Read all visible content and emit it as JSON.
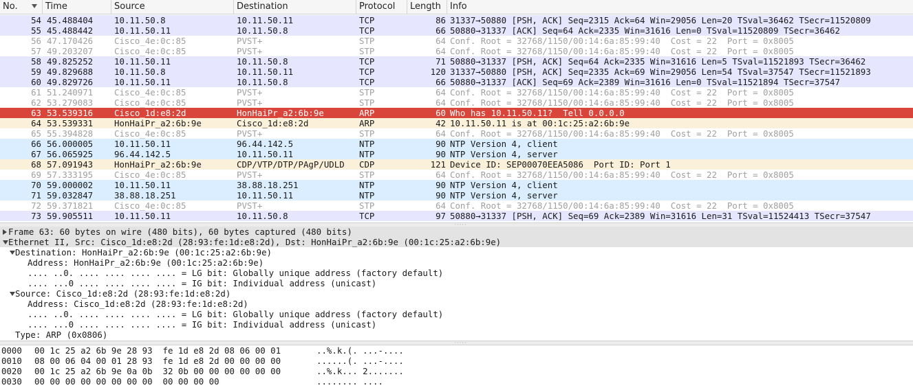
{
  "columns": [
    "No.",
    "Time",
    "Source",
    "Destination",
    "Protocol",
    "Length",
    "Info"
  ],
  "colors": {
    "tcp": "#e7e6ff",
    "stp": "#ffffff",
    "stp_text": "#a0a0a0",
    "selected": "#d9453a",
    "arp": "#fbf0d9",
    "ntp": "#daeeff",
    "cdp": "#fbf0d9"
  },
  "packets": [
    {
      "no": "54",
      "time": "45.488404",
      "src": "10.11.50.8",
      "dst": "10.11.50.11",
      "proto": "TCP",
      "len": "86",
      "info": "31337→50880 [PSH, ACK] Seq=2315 Ack=64 Win=29056 Len=20 TSval=36462 TSecr=11520809",
      "cls": "tcp"
    },
    {
      "no": "55",
      "time": "45.488442",
      "src": "10.11.50.11",
      "dst": "10.11.50.8",
      "proto": "TCP",
      "len": "66",
      "info": "50880→31337 [ACK] Seq=64 Ack=2335 Win=31616 Len=0 TSval=11520809 TSecr=36462",
      "cls": "tcp"
    },
    {
      "no": "56",
      "time": "47.170426",
      "src": "Cisco_4e:0c:85",
      "dst": "PVST+",
      "proto": "STP",
      "len": "64",
      "info": "Conf. Root = 32768/1150/00:14:6a:85:99:40  Cost = 22  Port = 0x8005",
      "cls": "stp"
    },
    {
      "no": "57",
      "time": "49.203207",
      "src": "Cisco_4e:0c:85",
      "dst": "PVST+",
      "proto": "STP",
      "len": "64",
      "info": "Conf. Root = 32768/1150/00:14:6a:85:99:40  Cost = 22  Port = 0x8005",
      "cls": "stp"
    },
    {
      "no": "58",
      "time": "49.825252",
      "src": "10.11.50.11",
      "dst": "10.11.50.8",
      "proto": "TCP",
      "len": "71",
      "info": "50880→31337 [PSH, ACK] Seq=64 Ack=2335 Win=31616 Len=5 TSval=11521893 TSecr=36462",
      "cls": "tcp"
    },
    {
      "no": "59",
      "time": "49.829688",
      "src": "10.11.50.8",
      "dst": "10.11.50.11",
      "proto": "TCP",
      "len": "120",
      "info": "31337→50880 [PSH, ACK] Seq=2335 Ack=69 Win=29056 Len=54 TSval=37547 TSecr=11521893",
      "cls": "tcp"
    },
    {
      "no": "60",
      "time": "49.829726",
      "src": "10.11.50.11",
      "dst": "10.11.50.8",
      "proto": "TCP",
      "len": "66",
      "info": "50880→31337 [ACK] Seq=69 Ack=2389 Win=31616 Len=0 TSval=11521894 TSecr=37547",
      "cls": "tcp"
    },
    {
      "no": "61",
      "time": "51.240971",
      "src": "Cisco_4e:0c:85",
      "dst": "PVST+",
      "proto": "STP",
      "len": "64",
      "info": "Conf. Root = 32768/1150/00:14:6a:85:99:40  Cost = 22  Port = 0x8005",
      "cls": "stp"
    },
    {
      "no": "62",
      "time": "53.279083",
      "src": "Cisco_4e:0c:85",
      "dst": "PVST+",
      "proto": "STP",
      "len": "64",
      "info": "Conf. Root = 32768/1150/00:14:6a:85:99:40  Cost = 22  Port = 0x8005",
      "cls": "stp"
    },
    {
      "no": "63",
      "time": "53.539316",
      "src": "Cisco_1d:e8:2d",
      "dst": "HonHaiPr_a2:6b:9e",
      "proto": "ARP",
      "len": "60",
      "info": "Who has 10.11.50.11?  Tell 0.0.0.0",
      "cls": "selected"
    },
    {
      "no": "64",
      "time": "53.539331",
      "src": "HonHaiPr_a2:6b:9e",
      "dst": "Cisco_1d:e8:2d",
      "proto": "ARP",
      "len": "42",
      "info": "10.11.50.11 is at 00:1c:25:a2:6b:9e",
      "cls": "arp"
    },
    {
      "no": "65",
      "time": "55.394828",
      "src": "Cisco_4e:0c:85",
      "dst": "PVST+",
      "proto": "STP",
      "len": "64",
      "info": "Conf. Root = 32768/1150/00:14:6a:85:99:40  Cost = 22  Port = 0x8005",
      "cls": "stp"
    },
    {
      "no": "66",
      "time": "56.000005",
      "src": "10.11.50.11",
      "dst": "96.44.142.5",
      "proto": "NTP",
      "len": "90",
      "info": "NTP Version 4, client",
      "cls": "ntp"
    },
    {
      "no": "67",
      "time": "56.065925",
      "src": "96.44.142.5",
      "dst": "10.11.50.11",
      "proto": "NTP",
      "len": "90",
      "info": "NTP Version 4, server",
      "cls": "ntp"
    },
    {
      "no": "68",
      "time": "57.091943",
      "src": "HonHaiPr_a2:6b:9e",
      "dst": "CDP/VTP/DTP/PAgP/UDLD",
      "proto": "CDP",
      "len": "121",
      "info": "Device ID: SEP00070EEA5086  Port ID: Port 1",
      "cls": "cdp"
    },
    {
      "no": "69",
      "time": "57.333195",
      "src": "Cisco_4e:0c:85",
      "dst": "PVST+",
      "proto": "STP",
      "len": "64",
      "info": "Conf. Root = 32768/1150/00:14:6a:85:99:40  Cost = 22  Port = 0x8005",
      "cls": "stp"
    },
    {
      "no": "70",
      "time": "59.000002",
      "src": "10.11.50.11",
      "dst": "38.88.18.251",
      "proto": "NTP",
      "len": "90",
      "info": "NTP Version 4, client",
      "cls": "ntp"
    },
    {
      "no": "71",
      "time": "59.032847",
      "src": "38.88.18.251",
      "dst": "10.11.50.11",
      "proto": "NTP",
      "len": "90",
      "info": "NTP Version 4, server",
      "cls": "ntp"
    },
    {
      "no": "72",
      "time": "59.371821",
      "src": "Cisco_4e:0c:85",
      "dst": "PVST+",
      "proto": "STP",
      "len": "64",
      "info": "Conf. Root = 32768/1150/00:14:6a:85:99:40  Cost = 22  Port = 0x8005",
      "cls": "stp"
    },
    {
      "no": "73",
      "time": "59.905511",
      "src": "10.11.50.11",
      "dst": "10.11.50.8",
      "proto": "TCP",
      "len": "97",
      "info": "50880→31337 [PSH, ACK] Seq=69 Ack=2389 Win=31616 Len=31 TSval=11524413 TSecr=37547",
      "cls": "tcp"
    }
  ],
  "details": [
    {
      "text": "Frame 63: 60 bytes on wire (480 bits), 60 bytes captured (480 bits)",
      "toggle": "closed",
      "level": 0,
      "hl": true
    },
    {
      "text": "Ethernet II, Src: Cisco_1d:e8:2d (28:93:fe:1d:e8:2d), Dst: HonHaiPr_a2:6b:9e (00:1c:25:a2:6b:9e)",
      "toggle": "open",
      "level": 0,
      "hl": true
    },
    {
      "text": "Destination: HonHaiPr_a2:6b:9e (00:1c:25:a2:6b:9e)",
      "toggle": "open",
      "level": 1,
      "hl": false
    },
    {
      "text": "Address: HonHaiPr_a2:6b:9e (00:1c:25:a2:6b:9e)",
      "toggle": "none",
      "level": 2,
      "hl": false
    },
    {
      "text": ".... ..0. .... .... .... .... = LG bit: Globally unique address (factory default)",
      "toggle": "none",
      "level": 2,
      "hl": false
    },
    {
      "text": ".... ...0 .... .... .... .... = IG bit: Individual address (unicast)",
      "toggle": "none",
      "level": 2,
      "hl": false
    },
    {
      "text": "Source: Cisco_1d:e8:2d (28:93:fe:1d:e8:2d)",
      "toggle": "open",
      "level": 1,
      "hl": false
    },
    {
      "text": "Address: Cisco_1d:e8:2d (28:93:fe:1d:e8:2d)",
      "toggle": "none",
      "level": 2,
      "hl": false
    },
    {
      "text": ".... ..0. .... .... .... .... = LG bit: Globally unique address (factory default)",
      "toggle": "none",
      "level": 2,
      "hl": false
    },
    {
      "text": ".... ...0 .... .... .... .... = IG bit: Individual address (unicast)",
      "toggle": "none",
      "level": 2,
      "hl": false
    },
    {
      "text": "Type: ARP (0x0806)",
      "toggle": "none",
      "level": 1,
      "hl": false
    }
  ],
  "bytes": [
    {
      "offset": "0000",
      "hex": "00 1c 25 a2 6b 9e 28 93  fe 1d e8 2d 08 06 00 01",
      "ascii": "..%.k.(. ...-...."
    },
    {
      "offset": "0010",
      "hex": "08 00 06 04 00 01 28 93  fe 1d e8 2d 00 00 00 00",
      "ascii": "......(. ...-...."
    },
    {
      "offset": "0020",
      "hex": "00 1c 25 a2 6b 9e 0a 0b  32 0b 00 00 00 00 00 00",
      "ascii": "..%.k... 2......."
    },
    {
      "offset": "0030",
      "hex": "00 00 00 00 00 00 00 00  00 00 00 00",
      "ascii": "........ ...."
    }
  ]
}
